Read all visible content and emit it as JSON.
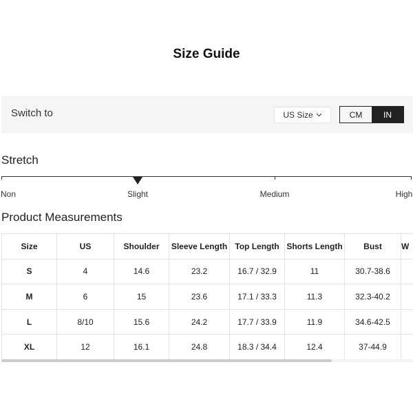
{
  "title": "Size Guide",
  "switch": {
    "label": "Switch to",
    "dropdown": "US Size",
    "dropdown_icon": "chevron-down-icon",
    "units": [
      "CM",
      "IN"
    ],
    "selected_unit": "IN"
  },
  "stretch": {
    "heading": "Stretch",
    "levels": [
      "Non",
      "Slight",
      "Medium",
      "High"
    ],
    "selected": "Slight"
  },
  "measurements": {
    "heading": "Product Measurements",
    "columns": [
      "Size",
      "US",
      "Shoulder",
      "Sleeve Length",
      "Top Length",
      "Shorts Length",
      "Bust",
      "W"
    ],
    "rows": [
      [
        "S",
        "4",
        "14.6",
        "23.2",
        "16.7 / 32.9",
        "11",
        "30.7-38.6"
      ],
      [
        "M",
        "6",
        "15",
        "23.6",
        "17.1 / 33.3",
        "11.3",
        "32.3-40.2"
      ],
      [
        "L",
        "8/10",
        "15.6",
        "24.2",
        "17.7 / 33.9",
        "11.9",
        "34.6-42.5"
      ],
      [
        "XL",
        "12",
        "16.1",
        "24.8",
        "18.3 / 34.4",
        "12.4",
        "37-44.9"
      ]
    ]
  }
}
